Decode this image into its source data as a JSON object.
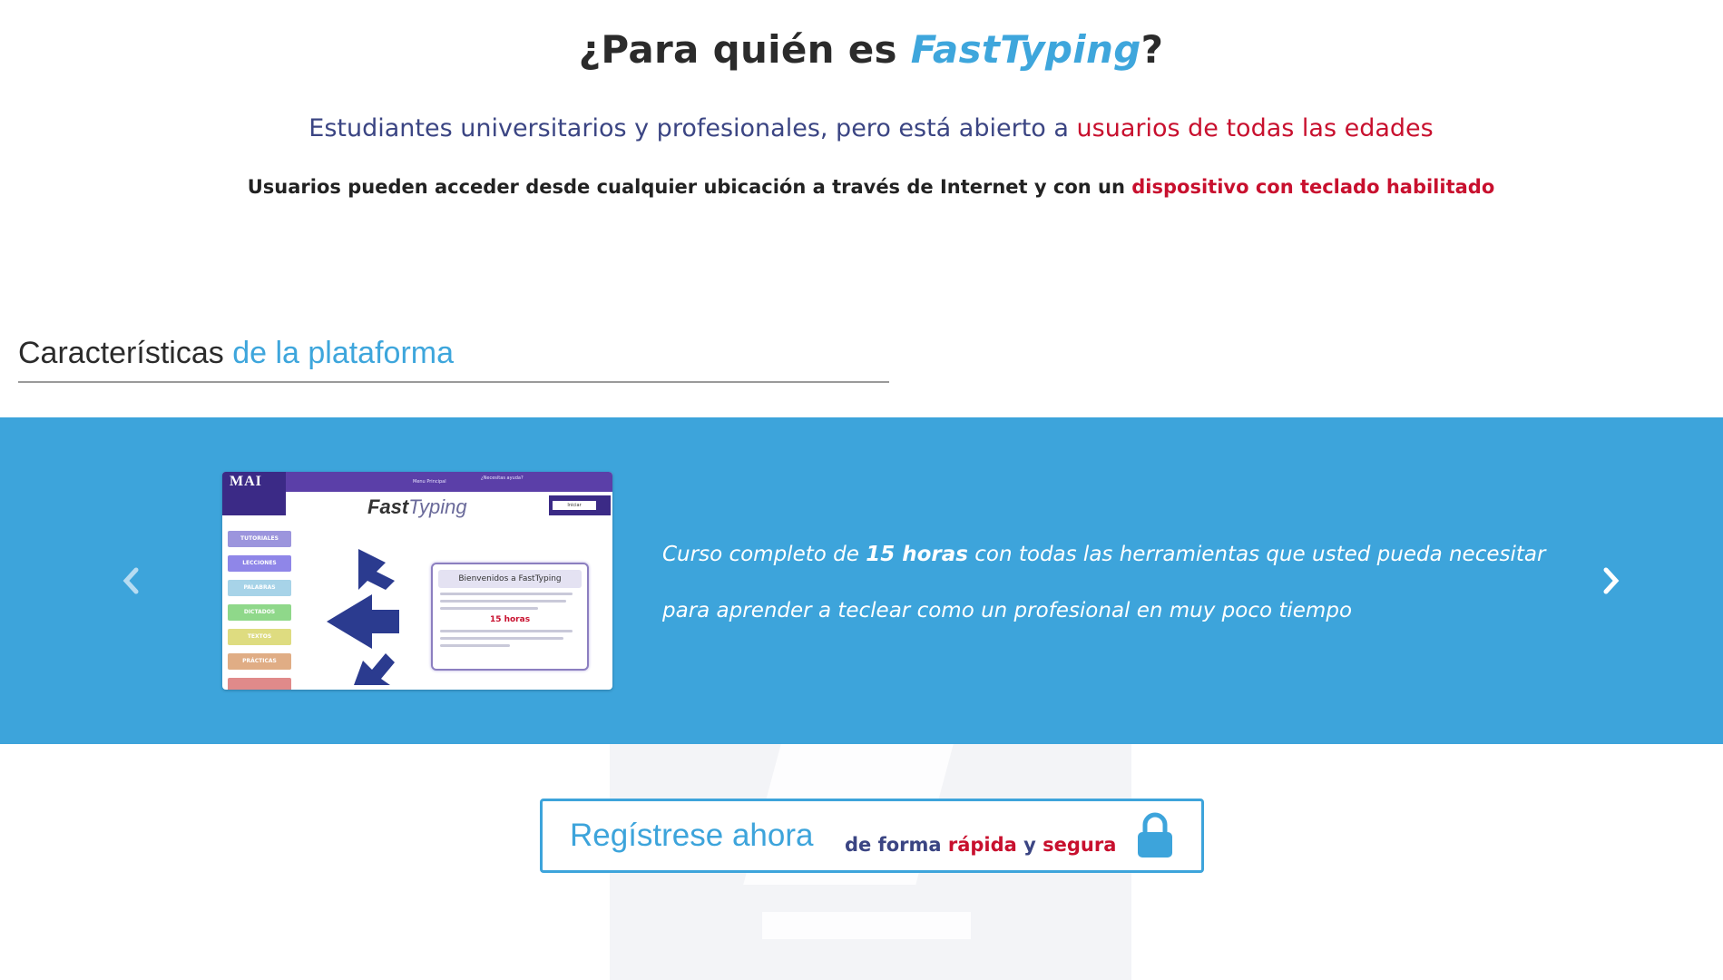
{
  "hero": {
    "title_prefix": "¿Para quién es ",
    "title_brand": "FastTyping",
    "title_suffix": "?",
    "subtitle_prefix": "Estudiantes universitarios y profesionales, pero está abierto a ",
    "subtitle_highlight": "usuarios de todas las edades",
    "subtitle2_prefix": "Usuarios pueden acceder desde cualquier ubicación a través de Internet y con un ",
    "subtitle2_highlight": "dispositivo con teclado habilitado"
  },
  "features": {
    "title_prefix": "Características ",
    "title_accent": "de la plataforma"
  },
  "carousel": {
    "prev_icon": "chevron-left-icon",
    "next_icon": "chevron-right-icon",
    "slide": {
      "text_line1_prefix": "Curso completo de ",
      "text_line1_bold": "15 horas",
      "text_line1_suffix": " con todas las herramientas que usted pueda necesitar",
      "text_line2": "para aprender a teclear como un profesional en muy poco tiempo",
      "mockup": {
        "logo": "MAI",
        "menu_title": "Menu Principal",
        "help": "¿Necesitas ayuda?",
        "brand_bold": "Fast",
        "brand_rest": "Typing",
        "login": "Iniciar",
        "welcome": "Bienvenidos a FastTyping",
        "hours": "15 horas",
        "menu_items": [
          "TUTORIALES",
          "LECCIONES",
          "PALABRAS",
          "DICTADOS",
          "TEXTOS",
          "PRÁCTICAS"
        ]
      }
    }
  },
  "register": {
    "main": "Regístrese ahora",
    "sub_prefix": "de forma ",
    "sub_hl1": "rápida",
    "sub_mid": " y ",
    "sub_hl2": "segura",
    "icon": "lock-icon"
  },
  "colors": {
    "accent_blue": "#3da4db",
    "highlight_red": "#c8102e",
    "navy": "#3b4583"
  }
}
